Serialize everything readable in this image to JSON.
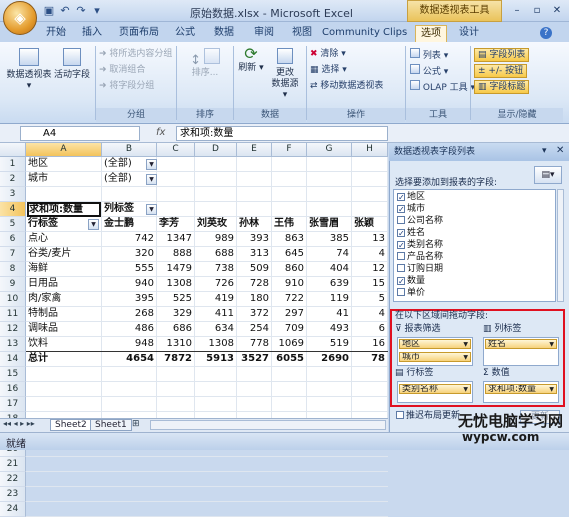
{
  "window": {
    "title": "原始数据.xlsx - Microsoft Excel",
    "context_tab_header": "数据透视表工具",
    "minimize": "–",
    "restore": "▫",
    "close": "✕"
  },
  "tabs": [
    "开始",
    "插入",
    "页面布局",
    "公式",
    "数据",
    "审阅",
    "视图",
    "Community Clips",
    "选项",
    "设计"
  ],
  "ribbon": {
    "pivot_table": "数据透视表",
    "active_field": "活动字段",
    "group_selection": "将所选内容分组",
    "ungroup": "取消组合",
    "group_field": "将字段分组",
    "sort": "排序...",
    "refresh": "刷新",
    "change_source_1": "更改",
    "change_source_2": "数据源",
    "clear": "清除",
    "select": "选择",
    "move_pivot": "移动数据透视表",
    "calculate_lists": "列表",
    "formulas": "公式",
    "olap_tools": "OLAP 工具",
    "field_list": "字段列表",
    "buttons": "+/- 按钮",
    "field_headers": "字段标题",
    "groups": {
      "group": "分组",
      "sort": "排序",
      "data": "数据",
      "actions": "操作",
      "tools": "工具",
      "show_hide": "显示/隐藏"
    }
  },
  "formula_bar": {
    "name_box": "A4",
    "fx": "fx",
    "formula": "求和项:数量"
  },
  "columns": [
    "A",
    "B",
    "C",
    "D",
    "E",
    "F",
    "G",
    "H"
  ],
  "rows": [
    {
      "n": "1",
      "a": "地区",
      "b": "(全部)",
      "dd": true
    },
    {
      "n": "2",
      "a": "城市",
      "b": "(全部)",
      "dd": true
    },
    {
      "n": "3"
    },
    {
      "n": "4",
      "a": "求和项:数量",
      "b": "列标签",
      "header": true
    },
    {
      "n": "5",
      "a": "行标签",
      "cells": [
        "金士鹏",
        "李芳",
        "刘英玫",
        "孙林",
        "王伟",
        "张雪眉",
        "张颖"
      ],
      "labels": true
    },
    {
      "n": "6",
      "a": "点心",
      "cells": [
        "742",
        "1347",
        "989",
        "393",
        "863",
        "385",
        "13"
      ]
    },
    {
      "n": "7",
      "a": "谷类/麦片",
      "cells": [
        "320",
        "888",
        "688",
        "313",
        "645",
        "74",
        "4"
      ]
    },
    {
      "n": "8",
      "a": "海鲜",
      "cells": [
        "555",
        "1479",
        "738",
        "509",
        "860",
        "404",
        "12"
      ]
    },
    {
      "n": "9",
      "a": "日用品",
      "cells": [
        "940",
        "1308",
        "726",
        "728",
        "910",
        "639",
        "15"
      ]
    },
    {
      "n": "10",
      "a": "肉/家禽",
      "cells": [
        "395",
        "525",
        "419",
        "180",
        "722",
        "119",
        "5"
      ]
    },
    {
      "n": "11",
      "a": "特制品",
      "cells": [
        "268",
        "329",
        "411",
        "372",
        "297",
        "41",
        "4"
      ]
    },
    {
      "n": "12",
      "a": "调味品",
      "cells": [
        "486",
        "686",
        "634",
        "254",
        "709",
        "493",
        "6"
      ]
    },
    {
      "n": "13",
      "a": "饮料",
      "cells": [
        "948",
        "1310",
        "1308",
        "778",
        "1069",
        "519",
        "16"
      ]
    },
    {
      "n": "14",
      "a": "总计",
      "cells": [
        "4654",
        "7872",
        "5913",
        "3527",
        "6055",
        "2690",
        "78"
      ],
      "total": true
    },
    {
      "n": "15"
    },
    {
      "n": "16"
    },
    {
      "n": "17"
    },
    {
      "n": "18"
    },
    {
      "n": "19"
    },
    {
      "n": "20"
    },
    {
      "n": "21"
    },
    {
      "n": "22"
    },
    {
      "n": "23"
    },
    {
      "n": "24"
    }
  ],
  "sheets": [
    "Sheet2",
    "Sheet1"
  ],
  "status": "就绪",
  "pane": {
    "title": "数据透视表字段列表",
    "choose_label": "选择要添加到报表的字段:",
    "fields": [
      {
        "name": "地区",
        "checked": true
      },
      {
        "name": "城市",
        "checked": true
      },
      {
        "name": "公司名称",
        "checked": false
      },
      {
        "name": "姓名",
        "checked": true
      },
      {
        "name": "类别名称",
        "checked": true
      },
      {
        "name": "产品名称",
        "checked": false
      },
      {
        "name": "订购日期",
        "checked": false
      },
      {
        "name": "数量",
        "checked": true
      },
      {
        "name": "单价",
        "checked": false
      }
    ],
    "drag_label": "在以下区域间拖动字段:",
    "report_filter": "报表筛选",
    "column_labels": "列标签",
    "row_labels": "行标签",
    "values": "数值",
    "filter_items": [
      "地区",
      "城市"
    ],
    "column_items": [
      "姓名"
    ],
    "row_items": [
      "类别名称"
    ],
    "value_items": [
      "求和项:数量"
    ],
    "defer_update": "推迟布局更新",
    "update": "更新"
  },
  "watermark": {
    "line1": "无忧电脑学习网",
    "line2": "wypcw.com"
  }
}
